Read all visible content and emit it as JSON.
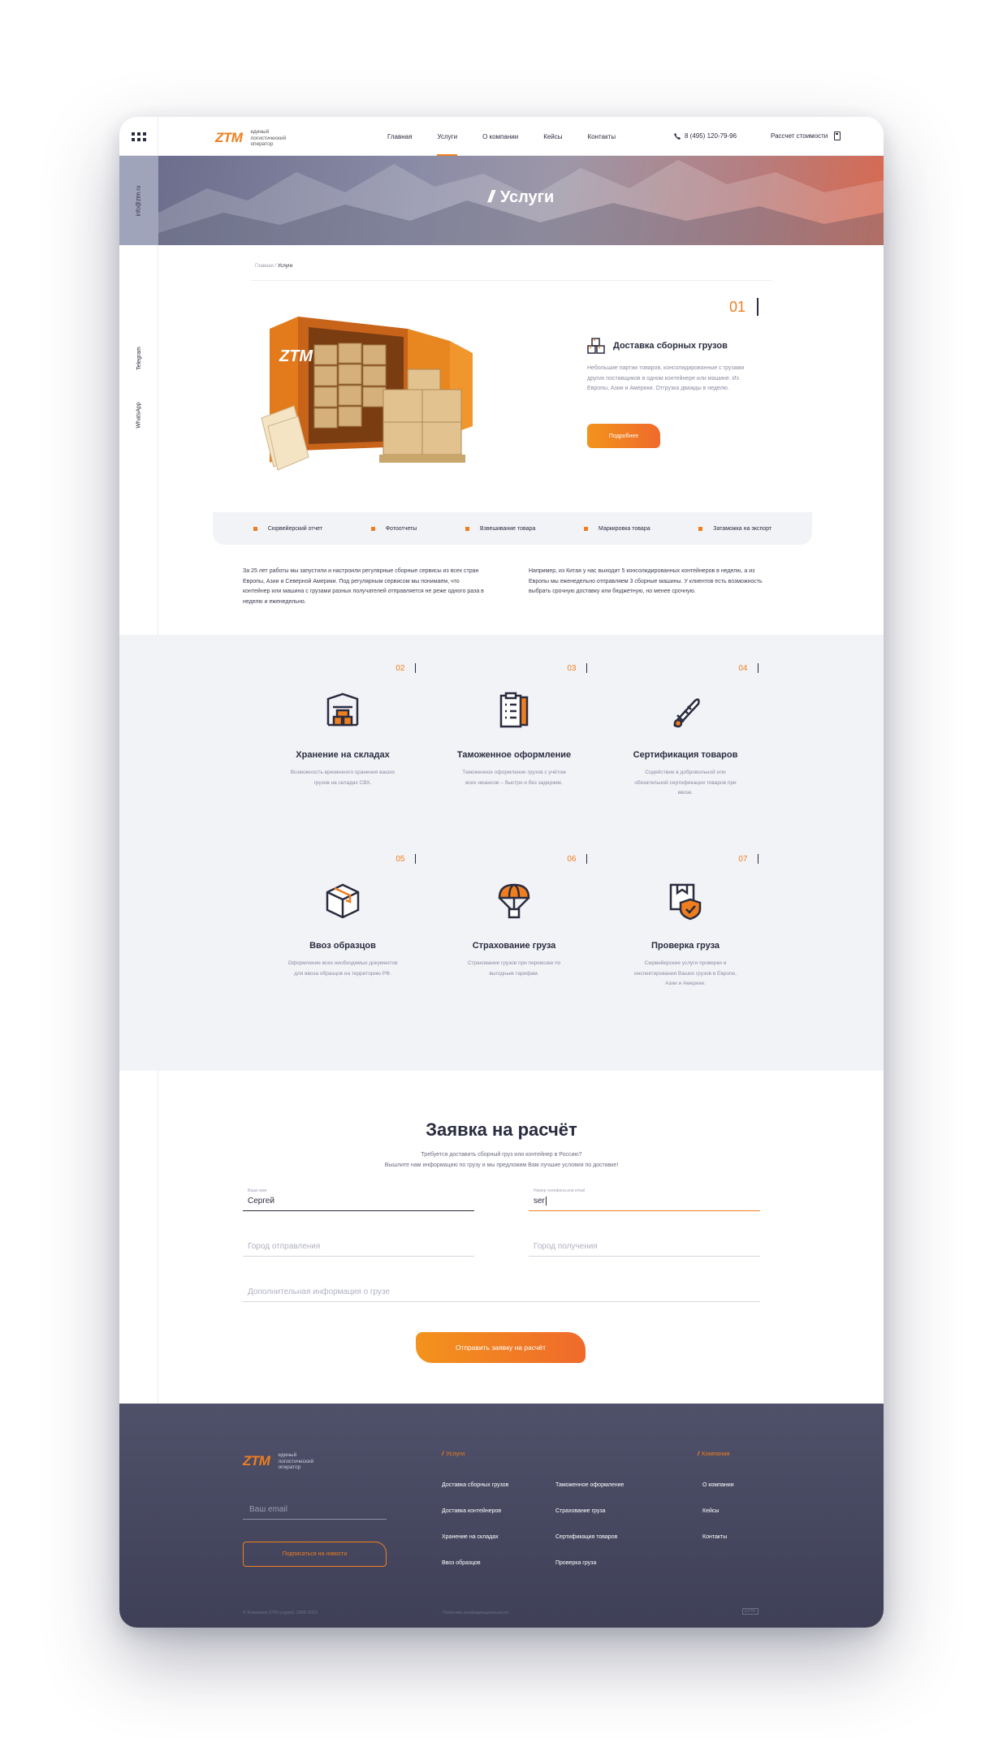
{
  "header": {
    "logo": "ZTM",
    "logo_tagline": "единый логистический оператор",
    "nav": [
      "Главная",
      "Услуги",
      "О компании",
      "Кейсы",
      "Контакты"
    ],
    "active_nav": "Услуги",
    "phone": "8 (495) 120-79-96",
    "calc_label": "Рассчет стоимости"
  },
  "sidebar": {
    "email": "info@ztm.ru",
    "telegram": "Telegram",
    "whatsapp": "WhatsApp"
  },
  "hero": {
    "title": "Услуги"
  },
  "breadcrumb": {
    "home": "Главная",
    "separator": "/",
    "current": "Услуги"
  },
  "featured": {
    "number": "01",
    "title": "Доставка сборных грузов",
    "description": "Небольшие партии товаров, консолидированные с грузами других поставщиков в одном контейнере или машине. Из Европы, Азии и Америки. Отгрузка дважды в неделю.",
    "button": "Подробнее"
  },
  "tags": [
    "Сюрвейерский отчет",
    "Фотоотчеты",
    "Взвешивание товара",
    "Маркировка товара",
    "Затаможка на экспорт"
  ],
  "about": {
    "left": "За 25 лет работы мы запустили и настроили регулярные сборные сервисы из всех стран Европы, Азии и Северной Америки. Под регулярным сервисом мы понимаем, что контейнер или машина с грузами разных получателей отправляется не реже одного раза в неделю и еженедельно.",
    "right": "Например, из Китая у нас выходит 5 консолидированных контейнеров в неделю, а из Европы мы еженедельно отправляем 3 сборные машины. У клиентов есть возможность выбрать срочную доставку или бюджетную, но менее срочную."
  },
  "services": [
    {
      "number": "02",
      "title": "Хранение на складах",
      "icon": "warehouse-icon",
      "description": "Возможность временного хранения ваших грузов на складах СВХ."
    },
    {
      "number": "03",
      "title": "Таможенное оформление",
      "icon": "clipboard-icon",
      "description": "Таможенное оформление грузов с учётом всех нюансов – быстро и без задержек."
    },
    {
      "number": "04",
      "title": "Сертификация товаров",
      "icon": "certificate-icon",
      "description": "Содействие в добровольной или обязательной сертификации товаров при ввозе."
    },
    {
      "number": "05",
      "title": "Ввоз образцов",
      "icon": "box-icon",
      "description": "Оформление всех необходимых документов для ввоза образцов на территорию РФ."
    },
    {
      "number": "06",
      "title": "Страхование груза",
      "icon": "parachute-icon",
      "description": "Страхование грузов при перевозке по выгодным тарифам."
    },
    {
      "number": "07",
      "title": "Проверка груза",
      "icon": "shield-box-icon",
      "description": "Сюрвейерские услуги проверки и инспектирования Ваших грузов в Европе, Азии и Америке."
    }
  ],
  "form": {
    "title": "Заявка на расчёт",
    "subtitle_1": "Требуется доставить сборный груз или контейнер в Россию?",
    "subtitle_2": "Вышлите нам информацию по грузу и мы предложим Вам лучшие условия по доставке!",
    "name_label": "Ваше имя",
    "name_value": "Сергей",
    "contact_label": "Номер телефона или email",
    "contact_value": "ser",
    "from_placeholder": "Город отправления",
    "to_placeholder": "Город получения",
    "info_placeholder": "Дополнительная информация о грузе",
    "submit": "Отправить заявку на расчёт"
  },
  "footer": {
    "logo": "ZTM",
    "logo_tagline": "единый логистический оператор",
    "email_placeholder": "Ваш email",
    "subscribe": "Подписаться на новости",
    "services_heading": "Услуги",
    "services_col1": [
      "Доставка сборных грузов",
      "Доставка контейнеров",
      "Хранение на складах",
      "Ввоз образцов"
    ],
    "services_col2": [
      "Таможенное оформление",
      "Страхование груза",
      "Сертификация товаров",
      "Проверка груза"
    ],
    "company_heading": "Компания",
    "company_links": [
      "О компании",
      "Кейсы",
      "Контакты"
    ],
    "copyright": "© Компания ZTM-Logistic 1995-2023",
    "policy": "Политика конфиденциальности",
    "developer": "EPIK"
  },
  "colors": {
    "accent": "#f07e1e",
    "accent_end": "#ef6a2b",
    "dark": "#2a2c3f",
    "footer": "#45465e",
    "grey_bg": "#f2f3f7"
  }
}
